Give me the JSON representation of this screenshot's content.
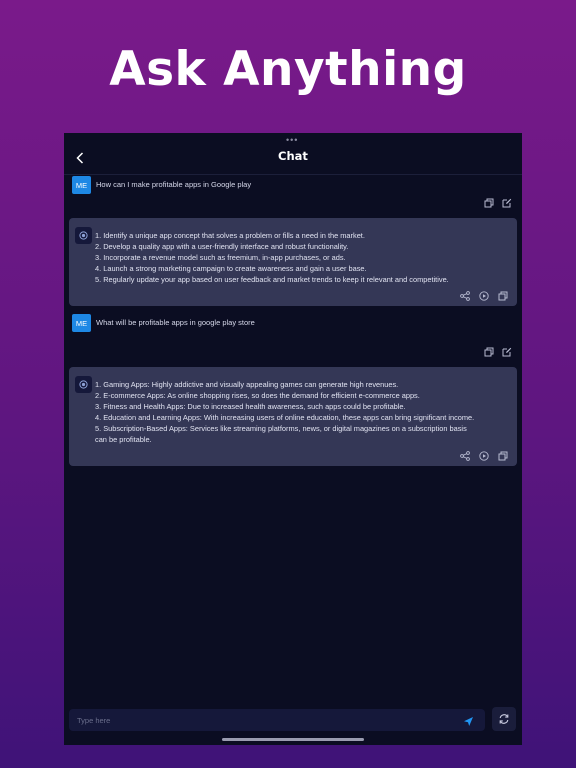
{
  "headline": "Ask Anything",
  "nav": {
    "title": "Chat"
  },
  "messages": [
    {
      "avatar": "ME",
      "text": "How can I make profitable apps in Google play",
      "answer": [
        "1. Identify a unique app concept that solves a problem or fills a need in the market.",
        "2. Develop a quality app with a user-friendly interface and robust functionality.",
        "3. Incorporate a revenue model such as freemium, in-app purchases, or ads.",
        "4. Launch a strong marketing campaign to create awareness and gain a user base.",
        "5. Regularly update your app based on user feedback and market trends to keep it relevant and competitive."
      ]
    },
    {
      "avatar": "ME",
      "text": "What will be profitable apps in google play store",
      "answer": [
        "1. Gaming Apps: Highly addictive and visually appealing games can generate high revenues.",
        "2. E-commerce Apps: As online shopping rises, so does the demand for efficient e-commerce apps.",
        "3. Fitness and Health Apps: Due to increased health awareness, such apps could be profitable.",
        "4. Education and Learning Apps: With increasing users of online education, these apps can bring significant income.",
        "5. Subscription-Based Apps: Services like streaming platforms, news, or digital magazines on a subscription basis",
        "can be profitable."
      ]
    }
  ],
  "composer": {
    "placeholder": "Type here"
  },
  "icons": {
    "back": "chevron-left-icon",
    "copy": "copy-icon",
    "edit": "edit-icon",
    "share": "share-icon",
    "play": "play-icon",
    "send": "send-icon",
    "refresh": "refresh-icon"
  },
  "colors": {
    "background_top": "#7a1a8a",
    "background_bottom": "#3f1378",
    "app_background": "#0b0d22",
    "answer_bubble": "#343756",
    "avatar": "#1e88e5",
    "send_icon": "#2196f3"
  }
}
